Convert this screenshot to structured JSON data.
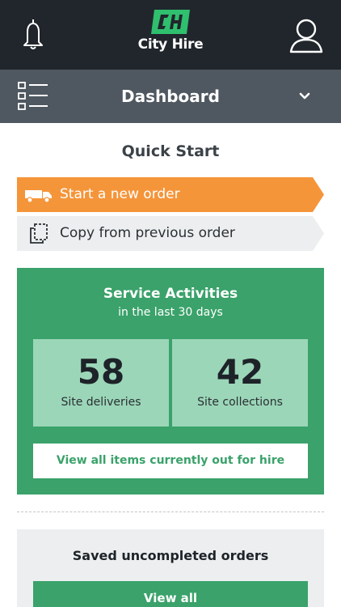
{
  "header": {
    "brand": "City Hire",
    "brand_color": "#2fbf6e",
    "bell_icon": "bell-icon",
    "user_icon": "user-icon"
  },
  "dashboard_bar": {
    "title": "Dashboard",
    "menu_icon": "list-menu-icon",
    "dropdown_icon": "chevron-down-icon"
  },
  "quick_start": {
    "title": "Quick Start",
    "new_order_label": "Start a new order",
    "new_order_color": "#f5953a",
    "copy_order_label": "Copy from previous order"
  },
  "service": {
    "title": "Service Activities",
    "subtitle": "in the last 30 days",
    "color": "#3aa26a",
    "stats": [
      {
        "value": "58",
        "label": "Site deliveries"
      },
      {
        "value": "42",
        "label": "Site collections"
      }
    ],
    "view_hire_label": "View all items currently out for hire"
  },
  "saved": {
    "title": "Saved uncompleted orders",
    "view_all_label": "View all"
  }
}
